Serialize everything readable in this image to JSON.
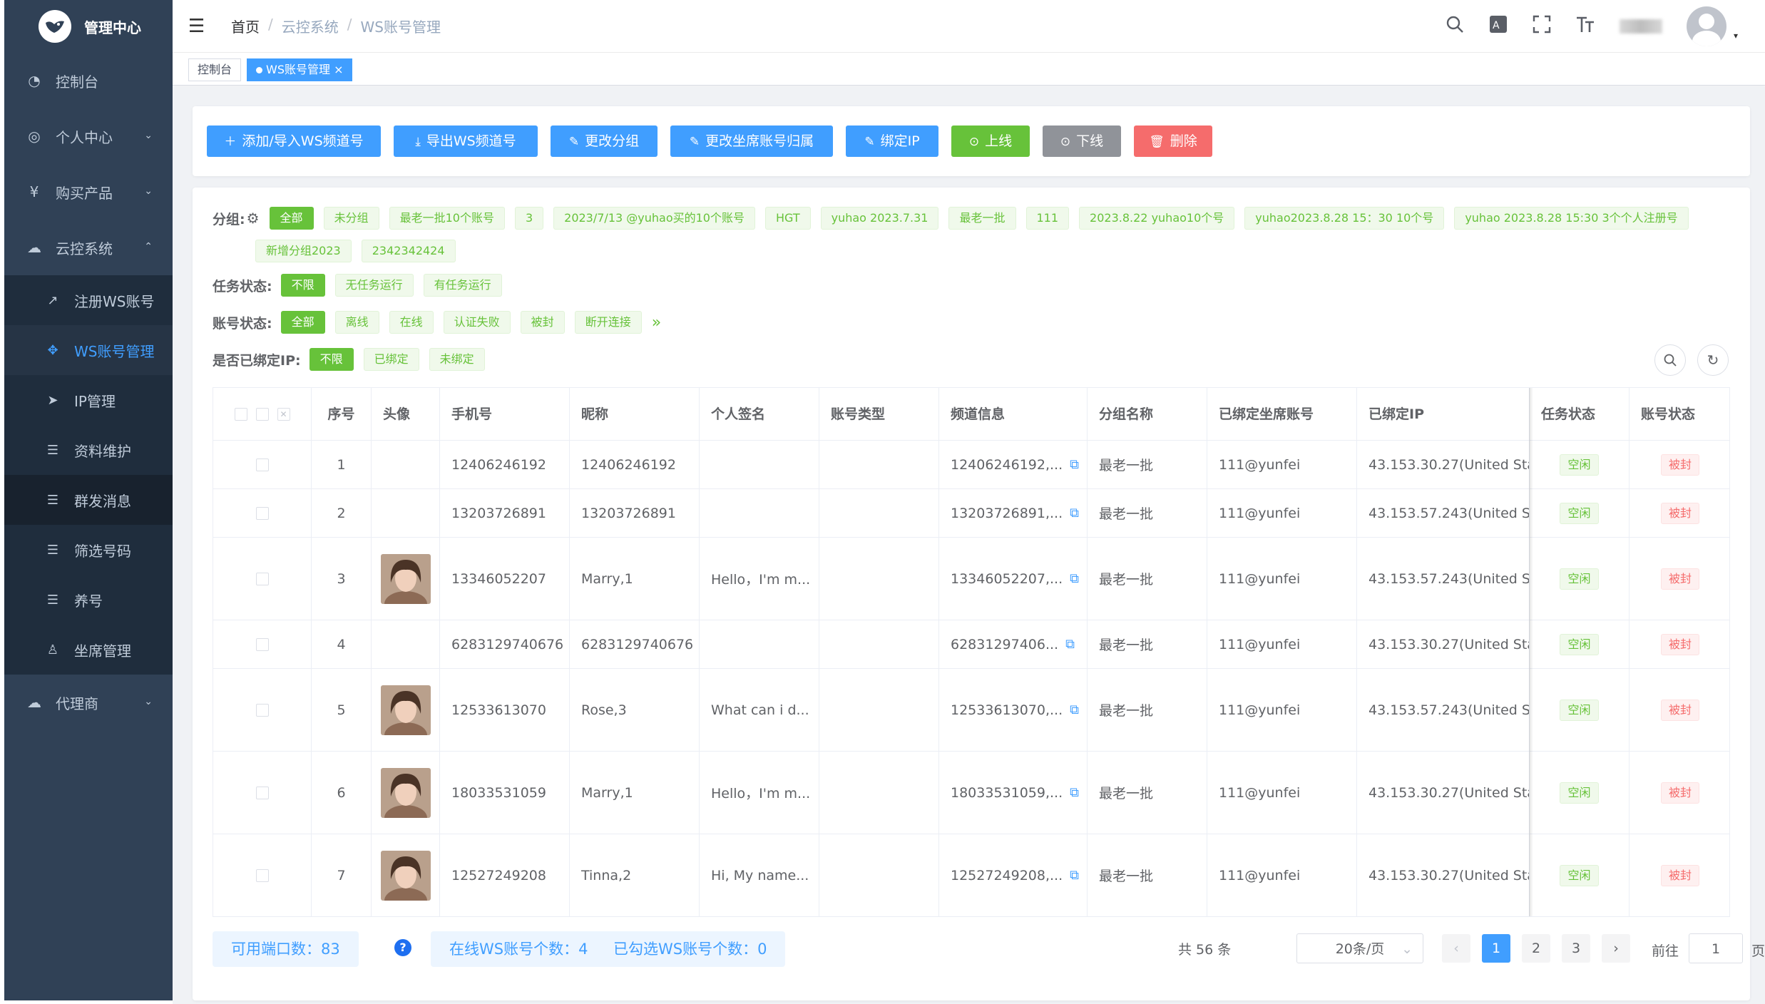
{
  "sidebar": {
    "title": "管理中心",
    "items": [
      {
        "icon": "dashboard-icon",
        "glyph": "◔",
        "label": "控制台"
      },
      {
        "icon": "user-circle-icon",
        "glyph": "◎",
        "label": "个人中心"
      },
      {
        "icon": "yen-icon",
        "glyph": "¥",
        "label": "购买产品"
      },
      {
        "icon": "cloud-icon",
        "glyph": "☁",
        "label": "云控系统"
      },
      {
        "icon": "agent-icon",
        "glyph": "☁",
        "label": "代理商"
      }
    ],
    "sub_items": [
      {
        "icon": "external-link-icon",
        "glyph": "↗",
        "label": "注册WS账号"
      },
      {
        "icon": "move-icon",
        "glyph": "✥",
        "label": "WS账号管理"
      },
      {
        "icon": "send-icon",
        "glyph": "➤",
        "label": "IP管理"
      },
      {
        "icon": "list-icon",
        "glyph": "☰",
        "label": "资料维护"
      },
      {
        "icon": "list-icon",
        "glyph": "☰",
        "label": "群发消息"
      },
      {
        "icon": "list-icon",
        "glyph": "☰",
        "label": "筛选号码"
      },
      {
        "icon": "list-icon",
        "glyph": "☰",
        "label": "养号"
      },
      {
        "icon": "person-icon",
        "glyph": "♙",
        "label": "坐席管理"
      }
    ]
  },
  "header": {
    "breadcrumb": [
      "首页",
      "云控系统",
      "WS账号管理"
    ],
    "sep": "/"
  },
  "tags": [
    {
      "label": "控制台"
    },
    {
      "label": "WS账号管理",
      "close": "×"
    }
  ],
  "toolbar": {
    "buttons": [
      {
        "label": "添加/导入WS频道号",
        "icon": "＋",
        "color": "#409eff"
      },
      {
        "label": "导出WS频道号",
        "icon": "⤓",
        "color": "#409eff"
      },
      {
        "label": "更改分组",
        "icon": "✎",
        "color": "#409eff"
      },
      {
        "label": "更改坐席账号归属",
        "icon": "✎",
        "color": "#409eff"
      },
      {
        "label": "绑定IP",
        "icon": "✎",
        "color": "#409eff"
      },
      {
        "label": "上线",
        "icon": "⊙",
        "color": "#67c23a"
      },
      {
        "label": "下线",
        "icon": "⊙",
        "color": "#909399"
      },
      {
        "label": "删除",
        "icon": "🗑",
        "color": "#f56c6c"
      }
    ]
  },
  "filters": {
    "group_label": "分组:",
    "groups": [
      "全部",
      "未分组",
      "最老一批10个账号",
      "3",
      "2023/7/13 @yuhao买的10个账号",
      "HGT",
      "yuhao 2023.7.31",
      "最老一批",
      "111",
      "2023.8.22 yuhao10个号",
      "yuhao2023.8.28 15：30 10个号",
      "yuhao 2023.8.28 15:30 3个个人注册号",
      "新增分组2023",
      "2342342424"
    ],
    "task_label": "任务状态:",
    "task": [
      "不限",
      "无任务运行",
      "有任务运行"
    ],
    "account_label": "账号状态:",
    "account": [
      "全部",
      "离线",
      "在线",
      "认证失败",
      "被封",
      "断开连接"
    ],
    "more": "»",
    "ip_label": "是否已绑定IP:",
    "ip": [
      "不限",
      "已绑定",
      "未绑定"
    ]
  },
  "table": {
    "headers": [
      "序号",
      "头像",
      "手机号",
      "昵称",
      "个人签名",
      "账号类型",
      "频道信息",
      "分组名称",
      "已绑定坐席账号",
      "已绑定IP",
      "任务状态",
      "账号状态"
    ],
    "rows": [
      {
        "no": "1",
        "avatar": false,
        "phone": "12406246192",
        "nick": "12406246192",
        "sign": "",
        "type": "",
        "channel": "12406246192,...",
        "group": "最老一批",
        "seat": "111@yunfei",
        "ip": "43.153.30.27(United Sta",
        "task": "空闲",
        "status": "被封"
      },
      {
        "no": "2",
        "avatar": false,
        "phone": "13203726891",
        "nick": "13203726891",
        "sign": "",
        "type": "",
        "channel": "13203726891,...",
        "group": "最老一批",
        "seat": "111@yunfei",
        "ip": "43.153.57.243(United S",
        "task": "空闲",
        "status": "被封"
      },
      {
        "no": "3",
        "avatar": true,
        "phone": "13346052207",
        "nick": "Marry,1",
        "sign": "Hello，I'm m...",
        "type": "",
        "channel": "13346052207,...",
        "group": "最老一批",
        "seat": "111@yunfei",
        "ip": "43.153.57.243(United S",
        "task": "空闲",
        "status": "被封"
      },
      {
        "no": "4",
        "avatar": false,
        "phone": "6283129740676",
        "nick": "6283129740676",
        "sign": "",
        "type": "",
        "channel": "62831297406...",
        "group": "最老一批",
        "seat": "111@yunfei",
        "ip": "43.153.30.27(United Sta",
        "task": "空闲",
        "status": "被封"
      },
      {
        "no": "5",
        "avatar": true,
        "phone": "12533613070",
        "nick": "Rose,3",
        "sign": "What can i d...",
        "type": "",
        "channel": "12533613070,...",
        "group": "最老一批",
        "seat": "111@yunfei",
        "ip": "43.153.57.243(United S",
        "task": "空闲",
        "status": "被封"
      },
      {
        "no": "6",
        "avatar": true,
        "phone": "18033531059",
        "nick": "Marry,1",
        "sign": "Hello，I'm m...",
        "type": "",
        "channel": "18033531059,...",
        "group": "最老一批",
        "seat": "111@yunfei",
        "ip": "43.153.30.27(United Sta",
        "task": "空闲",
        "status": "被封"
      },
      {
        "no": "7",
        "avatar": true,
        "phone": "12527249208",
        "nick": "Tinna,2",
        "sign": "Hi, My name...",
        "type": "",
        "channel": "12527249208,...",
        "group": "最老一批",
        "seat": "111@yunfei",
        "ip": "43.153.30.27(United Sta",
        "task": "空闲",
        "status": "被封"
      }
    ]
  },
  "footer": {
    "ports": "可用端口数：83",
    "help": "?",
    "online": "在线WS账号个数：4",
    "selected": "已勾选WS账号个数：0",
    "total": "共 56 条",
    "page_size": "20条/页",
    "pages": [
      "1",
      "2",
      "3"
    ],
    "prev": "‹",
    "next": "›",
    "goto_label": "前往",
    "goto_value": "1",
    "page_suffix": "页"
  }
}
